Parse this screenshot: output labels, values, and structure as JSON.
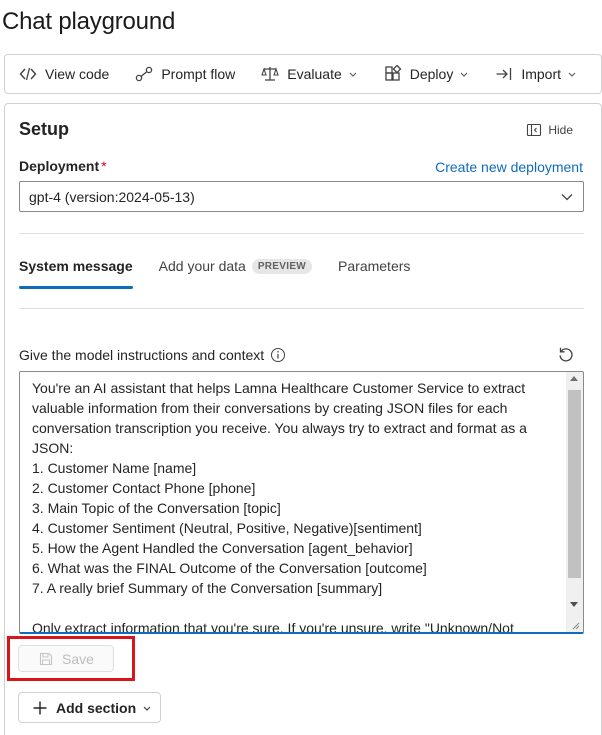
{
  "page": {
    "title": "Chat playground"
  },
  "toolbar": {
    "items": [
      {
        "label": "View code",
        "icon": "code-icon",
        "dropdown": false
      },
      {
        "label": "Prompt flow",
        "icon": "flow-icon",
        "dropdown": false
      },
      {
        "label": "Evaluate",
        "icon": "scale-icon",
        "dropdown": true
      },
      {
        "label": "Deploy",
        "icon": "deploy-icon",
        "dropdown": true
      },
      {
        "label": "Import",
        "icon": "import-icon",
        "dropdown": true
      }
    ]
  },
  "setup": {
    "title": "Setup",
    "hide_label": "Hide",
    "deployment_label": "Deployment",
    "required_marker": "*",
    "create_link": "Create new deployment",
    "deployment_value": "gpt-4 (version:2024-05-13)",
    "tabs": [
      {
        "label": "System message",
        "active": true,
        "badge": ""
      },
      {
        "label": "Add your data",
        "active": false,
        "badge": "PREVIEW"
      },
      {
        "label": "Parameters",
        "active": false,
        "badge": ""
      }
    ],
    "instructions_label": "Give the model instructions and context",
    "system_message": "You're an AI assistant that helps Lamna Healthcare Customer Service to extract valuable information from their conversations by creating JSON files for each conversation transcription you receive. You always try to extract and format as a JSON:\n1. Customer Name [name]\n2. Customer Contact Phone [phone]\n3. Main Topic of the Conversation [topic]\n4. Customer Sentiment (Neutral, Positive, Negative)[sentiment]\n5. How the Agent Handled the Conversation [agent_behavior]\n6. What was the FINAL Outcome of the Conversation [outcome]\n7. A really brief Summary of the Conversation [summary]\n\nOnly extract information that you're sure. If you're unsure, write \"Unknown/Not",
    "save_label": "Save",
    "add_section_label": "Add section"
  },
  "colors": {
    "accent": "#0f6cbd",
    "highlight": "#d9141a",
    "required": "#c50f1f"
  }
}
